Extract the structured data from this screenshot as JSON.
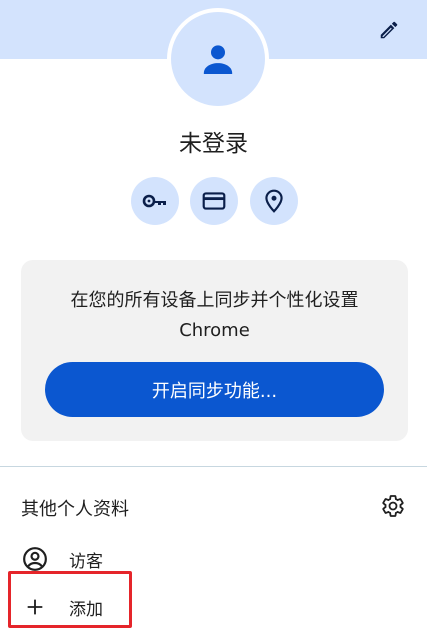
{
  "profile": {
    "name": "未登录",
    "avatar_icon": "person-icon",
    "edit_icon": "pencil-icon"
  },
  "quick_actions": [
    {
      "name": "passwords",
      "icon": "key-icon"
    },
    {
      "name": "payment-methods",
      "icon": "credit-card-icon"
    },
    {
      "name": "addresses",
      "icon": "location-pin-icon"
    }
  ],
  "sync_card": {
    "message_line1": "在您的所有设备上同步并个性化设置",
    "message_line2": "Chrome",
    "button_label": "开启同步功能..."
  },
  "other_profiles": {
    "title": "其他个人资料",
    "settings_icon": "gear-icon",
    "items": [
      {
        "label": "访客",
        "icon": "account-circle-icon"
      },
      {
        "label": "添加",
        "icon": "plus-icon"
      }
    ]
  },
  "colors": {
    "header_band": "#d3e3fd",
    "accent": "#0b57d0",
    "icon": "#0b1f4a",
    "card_bg": "#f2f2f2",
    "highlight": "#e5252a"
  }
}
